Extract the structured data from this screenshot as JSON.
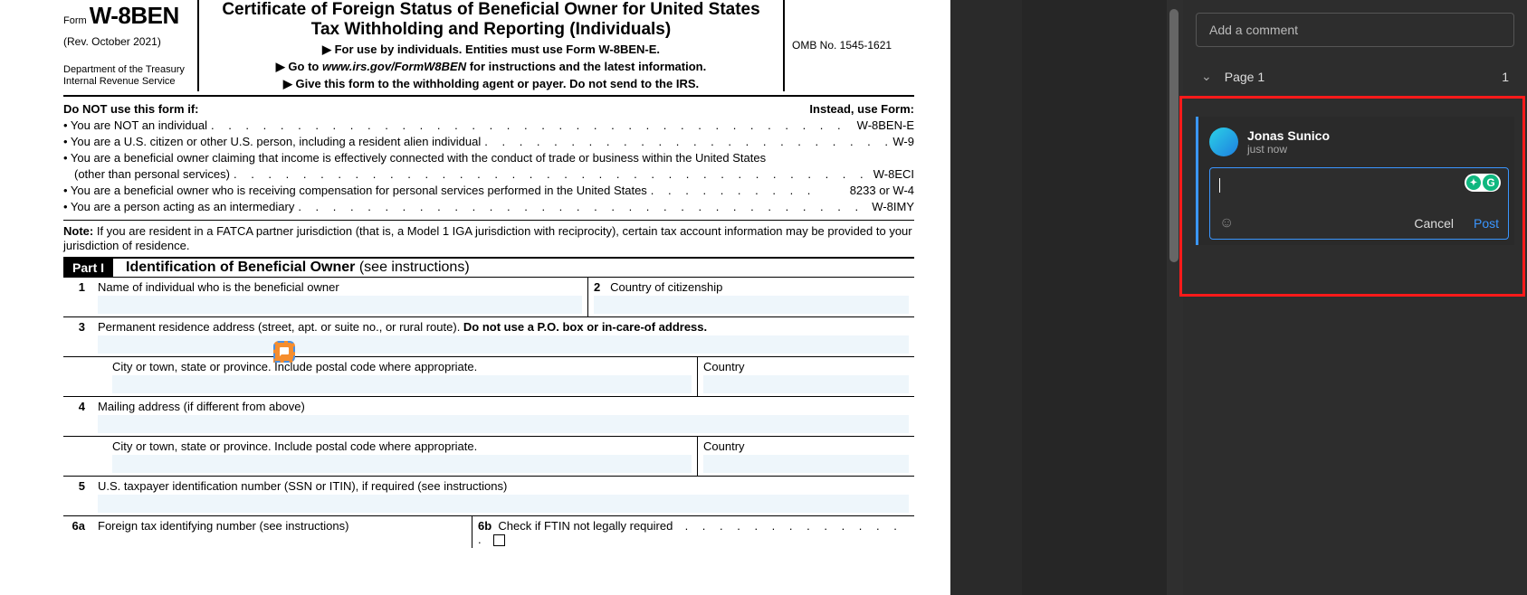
{
  "form": {
    "form_label": "Form",
    "form_name": "W-8BEN",
    "rev": "(Rev. October  2021)",
    "dept1": "Department of the Treasury",
    "dept2": "Internal Revenue Service",
    "title": "Certificate of Foreign Status of Beneficial Owner for United States Tax Withholding and Reporting (Individuals)",
    "sub1": "▶ For use by individuals. Entities must use Form W-8BEN-E.",
    "sub2_a": "▶ Go to ",
    "sub2_b": "www.irs.gov/FormW8BEN",
    "sub2_c": " for instructions and the latest information.",
    "sub3": "▶ Give this form to the withholding agent or payer. Do not send to the IRS.",
    "omb": "OMB No. 1545-1621"
  },
  "donot": {
    "left": "Do NOT use this form if:",
    "right": "Instead, use Form:",
    "rows": [
      {
        "txt": "• You are NOT an individual",
        "ref": "W-8BEN-E"
      },
      {
        "txt": "• You are a U.S. citizen or other U.S. person, including a resident alien individual",
        "ref": "W-9"
      },
      {
        "txt": "• You are a beneficial owner claiming that income is effectively connected with the conduct of a trade or business within the United States (other than personal services)",
        "ref": "W-8ECI",
        "wrap": true
      },
      {
        "txt": "• You are a beneficial owner who is receiving compensation for personal services performed in the United States",
        "ref": "8233 or W-4"
      },
      {
        "txt": "• You are a person acting as an intermediary",
        "ref": "W-8IMY"
      }
    ],
    "note_b": "Note:",
    "note": " If you are resident in a FATCA partner jurisdiction (that is, a Model 1 IGA jurisdiction with reciprocity), certain tax account information may be provided to your jurisdiction of residence."
  },
  "part1": {
    "label": "Part I",
    "title": "Identification of Beneficial Owner",
    "title_light": " (see instructions)",
    "fields": {
      "f1_num": "1",
      "f1_lbl": "Name of individual who is the beneficial owner",
      "f2_num": "2",
      "f2_lbl": "Country of citizenship",
      "f3_num": "3",
      "f3_lbl_a": "Permanent residence address (street, apt. or suite no., or rural route). ",
      "f3_lbl_b": "Do not use a P.O. box or in-care-of address.",
      "f3_city": "City or town, state or province. Include postal code where appropriate.",
      "f3_country": "Country",
      "f4_num": "4",
      "f4_lbl": "Mailing address (if different from above)",
      "f4_city": "City or town, state or province. Include postal code where appropriate.",
      "f4_country": "Country",
      "f5_num": "5",
      "f5_lbl": "U.S. taxpayer identification number (SSN or ITIN), if required (see instructions)",
      "f6a_num": "6a",
      "f6a_lbl": "Foreign tax identifying number (see instructions)",
      "f6b_num": "6b",
      "f6b_lbl": "Check if FTIN not legally required"
    }
  },
  "sidebar": {
    "add_placeholder": "Add a comment",
    "page_label": "Page 1",
    "page_count": "1",
    "user_name": "Jonas Sunico",
    "user_time": "just now",
    "cancel": "Cancel",
    "post": "Post",
    "gram_a": "✦",
    "gram_b": "G"
  }
}
